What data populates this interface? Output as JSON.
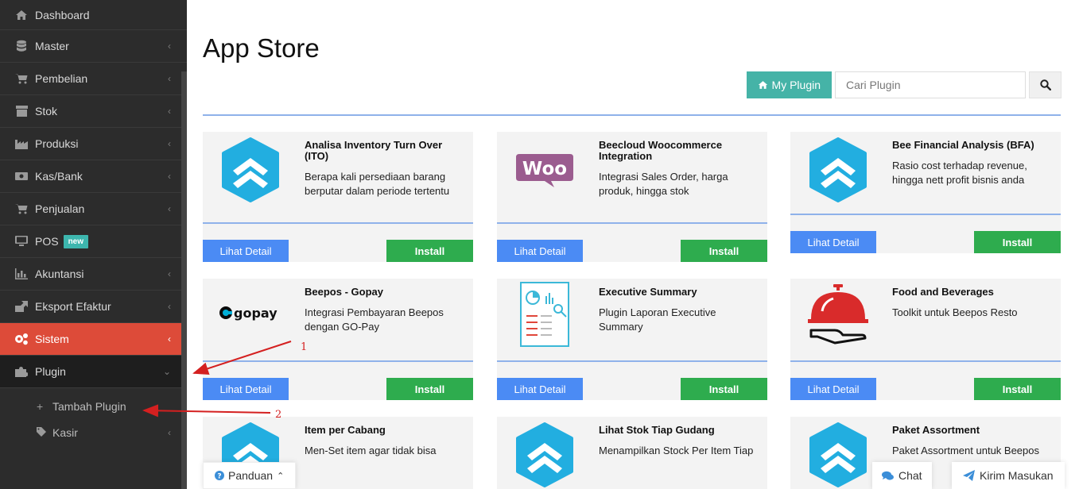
{
  "sidebar": {
    "items": [
      {
        "label": "Dashboard",
        "icon": "home-icon"
      },
      {
        "label": "Master",
        "icon": "database-icon"
      },
      {
        "label": "Pembelian",
        "icon": "cart-icon"
      },
      {
        "label": "Stok",
        "icon": "archive-icon"
      },
      {
        "label": "Produksi",
        "icon": "industry-icon"
      },
      {
        "label": "Kas/Bank",
        "icon": "money-icon"
      },
      {
        "label": "Penjualan",
        "icon": "cart-icon"
      },
      {
        "label": "POS",
        "icon": "desktop-icon",
        "badge": "new"
      },
      {
        "label": "Akuntansi",
        "icon": "bar-chart-icon"
      },
      {
        "label": "Eksport Efaktur",
        "icon": "export-icon"
      },
      {
        "label": "Sistem",
        "icon": "gears-icon"
      },
      {
        "label": "Plugin",
        "icon": "puzzle-icon"
      }
    ],
    "submenu": [
      {
        "label": "Tambah Plugin",
        "icon": "plus-icon"
      },
      {
        "label": "Kasir",
        "icon": "tags-icon"
      }
    ],
    "colors": {
      "active": "#dd4b39",
      "bg": "#2c2c2c",
      "badge": "#3db6ae"
    }
  },
  "main": {
    "title": "App Store",
    "my_plugin_label": "My Plugin",
    "search_placeholder": "Cari Plugin"
  },
  "cards": [
    {
      "title": "Analisa Inventory Turn Over (ITO)",
      "desc": "Berapa kali persediaan barang berputar dalam periode tertentu",
      "logo": "beecloud-logo"
    },
    {
      "title": "Beecloud Woocommerce Integration",
      "desc": "Integrasi Sales Order, harga produk, hingga stok",
      "logo": "woo-logo",
      "logo_text": "Woo"
    },
    {
      "title": "Bee Financial Analysis (BFA)",
      "desc": "Rasio cost terhadap revenue, hingga nett profit bisnis anda",
      "logo": "beecloud-logo"
    },
    {
      "title": "Beepos - Gopay",
      "desc": "Integrasi Pembayaran Beepos dengan GO-Pay",
      "logo": "gopay-logo",
      "logo_text": "gopay"
    },
    {
      "title": "Executive Summary",
      "desc": "Plugin Laporan Executive Summary",
      "logo": "report-logo"
    },
    {
      "title": "Food and Beverages",
      "desc": "Toolkit untuk Beepos Resto",
      "logo": "cloche-logo"
    },
    {
      "title": "Item per Cabang",
      "desc": "Men-Set item agar tidak bisa",
      "logo": "beecloud-logo"
    },
    {
      "title": "Lihat Stok Tiap Gudang",
      "desc": "Menampilkan Stock Per Item Tiap",
      "logo": "beecloud-logo"
    },
    {
      "title": "Paket Assortment",
      "desc": "Paket Assortment untuk Beepos",
      "logo": "beecloud-logo"
    }
  ],
  "buttons": {
    "detail": "Lihat Detail",
    "install": "Install"
  },
  "footer": {
    "panduan": "Panduan",
    "chat": "Chat",
    "kirim": "Kirim Masukan"
  },
  "annotations": [
    "1",
    "2"
  ],
  "colors": {
    "teal": "#45b3a7",
    "blue": "#4b8bf4",
    "green": "#2eac4e",
    "line": "#8fb2ea",
    "annotation": "#d42020"
  }
}
